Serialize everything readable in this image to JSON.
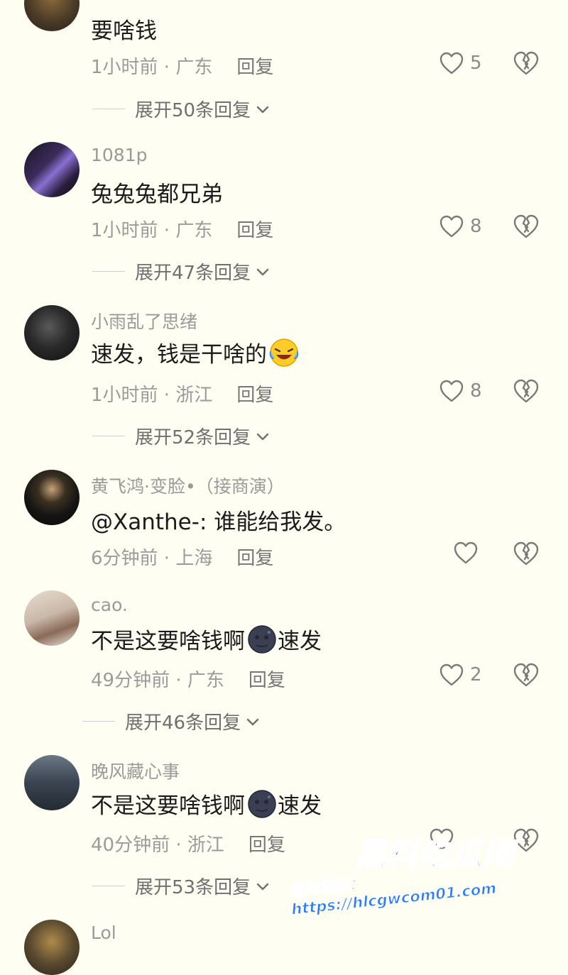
{
  "comments": [
    {
      "name": "",
      "text": "要啥钱",
      "time": "1小时前",
      "location": "广东",
      "reply": "回复",
      "likes": "5",
      "expand": "展开50条回复"
    },
    {
      "name": "1081p",
      "text": "兔兔兔都兄弟",
      "time": "1小时前",
      "location": "广东",
      "reply": "回复",
      "likes": "8",
      "expand": "展开47条回复"
    },
    {
      "name": "小雨乱了思绪",
      "text": "速发，钱是干啥的",
      "time": "1小时前",
      "location": "浙江",
      "reply": "回复",
      "likes": "8",
      "expand": "展开52条回复"
    },
    {
      "name": "黄飞鸿·变脸•（接商演）",
      "text": "@Xanthe-: 谁能给我发。",
      "time": "6分钟前",
      "location": "上海",
      "reply": "回复",
      "likes": "",
      "expand": ""
    },
    {
      "name": "cao.",
      "text_before": "不是这要啥钱啊",
      "text_after": "速发",
      "time": "49分钟前",
      "location": "广东",
      "reply": "回复",
      "likes": "2",
      "expand": "展开46条回复"
    },
    {
      "name": "晚风藏心事",
      "text_before": "不是这要啥钱啊",
      "text_after": "速发",
      "time": "40分钟前",
      "location": "浙江",
      "reply": "回复",
      "likes": "",
      "expand": "展开53条回复"
    },
    {
      "name": "Lol"
    }
  ],
  "separator": " · ",
  "icons": {
    "like": "heart-icon",
    "dislike": "broken-heart-icon",
    "expand": "chevron-down-icon",
    "emoji_laugh": "laughing-crying-emoji",
    "emoji_moon": "new-moon-face-emoji"
  },
  "watermark": {
    "title": "黑料吃瓜网",
    "url": "看完整版：https://hlcgwcom01.com"
  },
  "colors": {
    "background": "#fffef2",
    "meta": "#9b9b9b",
    "watermark": "#2a7bff"
  }
}
